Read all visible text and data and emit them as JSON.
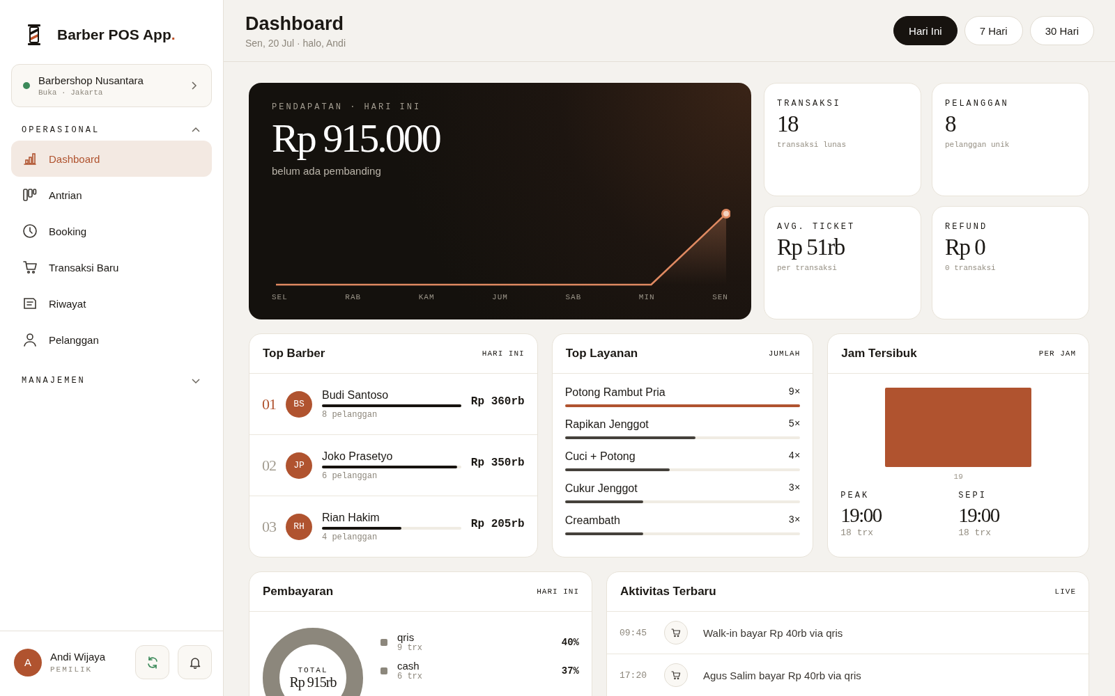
{
  "brand": {
    "name": "Barber POS App",
    "dot": "."
  },
  "shop": {
    "name": "Barbershop Nusantara",
    "status": "Buka · Jakarta",
    "open": true
  },
  "nav_sections": [
    {
      "title": "OPERASIONAL",
      "expanded": true,
      "items": [
        {
          "label": "Dashboard",
          "selected": true
        },
        {
          "label": "Antrian",
          "selected": false
        },
        {
          "label": "Booking",
          "selected": false
        },
        {
          "label": "Transaksi Baru",
          "selected": false
        },
        {
          "label": "Riwayat",
          "selected": false
        },
        {
          "label": "Pelanggan",
          "selected": false
        }
      ]
    },
    {
      "title": "MANAJEMEN",
      "expanded": false
    }
  ],
  "user": {
    "initial": "A",
    "name": "Andi Wijaya",
    "role": "PEMILIK"
  },
  "header": {
    "title": "Dashboard",
    "subtitle": "Sen, 20 Jul · halo, Andi"
  },
  "ranges": [
    {
      "label": "Hari Ini",
      "selected": true
    },
    {
      "label": "7 Hari",
      "selected": false
    },
    {
      "label": "30 Hari",
      "selected": false
    }
  ],
  "revenue": {
    "label": "PENDAPATAN · HARI INI",
    "value": "Rp 915.000",
    "note": "belum ada pembanding",
    "axis_labels": [
      "SEL",
      "RAB",
      "KAM",
      "JUM",
      "SAB",
      "MIN",
      "SEN"
    ]
  },
  "stats": [
    {
      "label": "TRANSAKSI",
      "value": "18",
      "note": "transaksi lunas"
    },
    {
      "label": "PELANGGAN",
      "value": "8",
      "note": "pelanggan unik"
    },
    {
      "label": "AVG. TICKET",
      "value": "Rp 51rb",
      "note": "per transaksi"
    },
    {
      "label": "REFUND",
      "value": "Rp 0",
      "note": "0 transaksi"
    }
  ],
  "top_barber": {
    "title": "Top Barber",
    "tag": "HARI INI",
    "rows": [
      {
        "rank": "01",
        "highlight": true,
        "initials": "BS",
        "name": "Budi Santoso",
        "level": 1.0,
        "amount": "Rp 360rb",
        "note": "8 pelanggan"
      },
      {
        "rank": "02",
        "highlight": false,
        "initials": "JP",
        "name": "Joko Prasetyo",
        "level": 0.97,
        "amount": "Rp 350rb",
        "note": "6 pelanggan"
      },
      {
        "rank": "03",
        "highlight": false,
        "initials": "RH",
        "name": "Rian Hakim",
        "level": 0.57,
        "amount": "Rp 205rb",
        "note": "4 pelanggan"
      }
    ]
  },
  "top_services": {
    "title": "Top Layanan",
    "tag": "JUMLAH",
    "rows": [
      {
        "name": "Potong Rambut Pria",
        "count": "9×",
        "level": 1.0,
        "highlight": true
      },
      {
        "name": "Rapikan Jenggot",
        "count": "5×",
        "level": 0.555,
        "highlight": false
      },
      {
        "name": "Cuci + Potong",
        "count": "4×",
        "level": 0.444,
        "highlight": false
      },
      {
        "name": "Cukur Jenggot",
        "count": "3×",
        "level": 0.333,
        "highlight": false
      },
      {
        "name": "Creambath",
        "count": "3×",
        "level": 0.333,
        "highlight": false
      }
    ]
  },
  "busiest": {
    "title": "Jam Tersibuk",
    "tag": "PER JAM",
    "bar_label": "19",
    "peak": {
      "label": "PEAK",
      "value": "19:00",
      "note": "18 trx"
    },
    "quiet": {
      "label": "SEPI",
      "value": "19:00",
      "note": "18 trx"
    }
  },
  "payments": {
    "title": "Pembayaran",
    "tag": "HARI INI",
    "total_label": "TOTAL",
    "total": "Rp 915rb",
    "methods": [
      {
        "name": "qris",
        "note": "9 trx",
        "share": "40%",
        "color": "#8c877c"
      },
      {
        "name": "cash",
        "note": "6 trx",
        "share": "37%",
        "color": "#8c877c"
      }
    ]
  },
  "activity": {
    "title": "Aktivitas Terbaru",
    "tag": "LIVE",
    "items": [
      {
        "time": "09:45",
        "text": "Walk-in bayar Rp 40rb via qris"
      },
      {
        "time": "17:20",
        "text": "Agus Salim bayar Rp 40rb via qris"
      }
    ]
  }
}
